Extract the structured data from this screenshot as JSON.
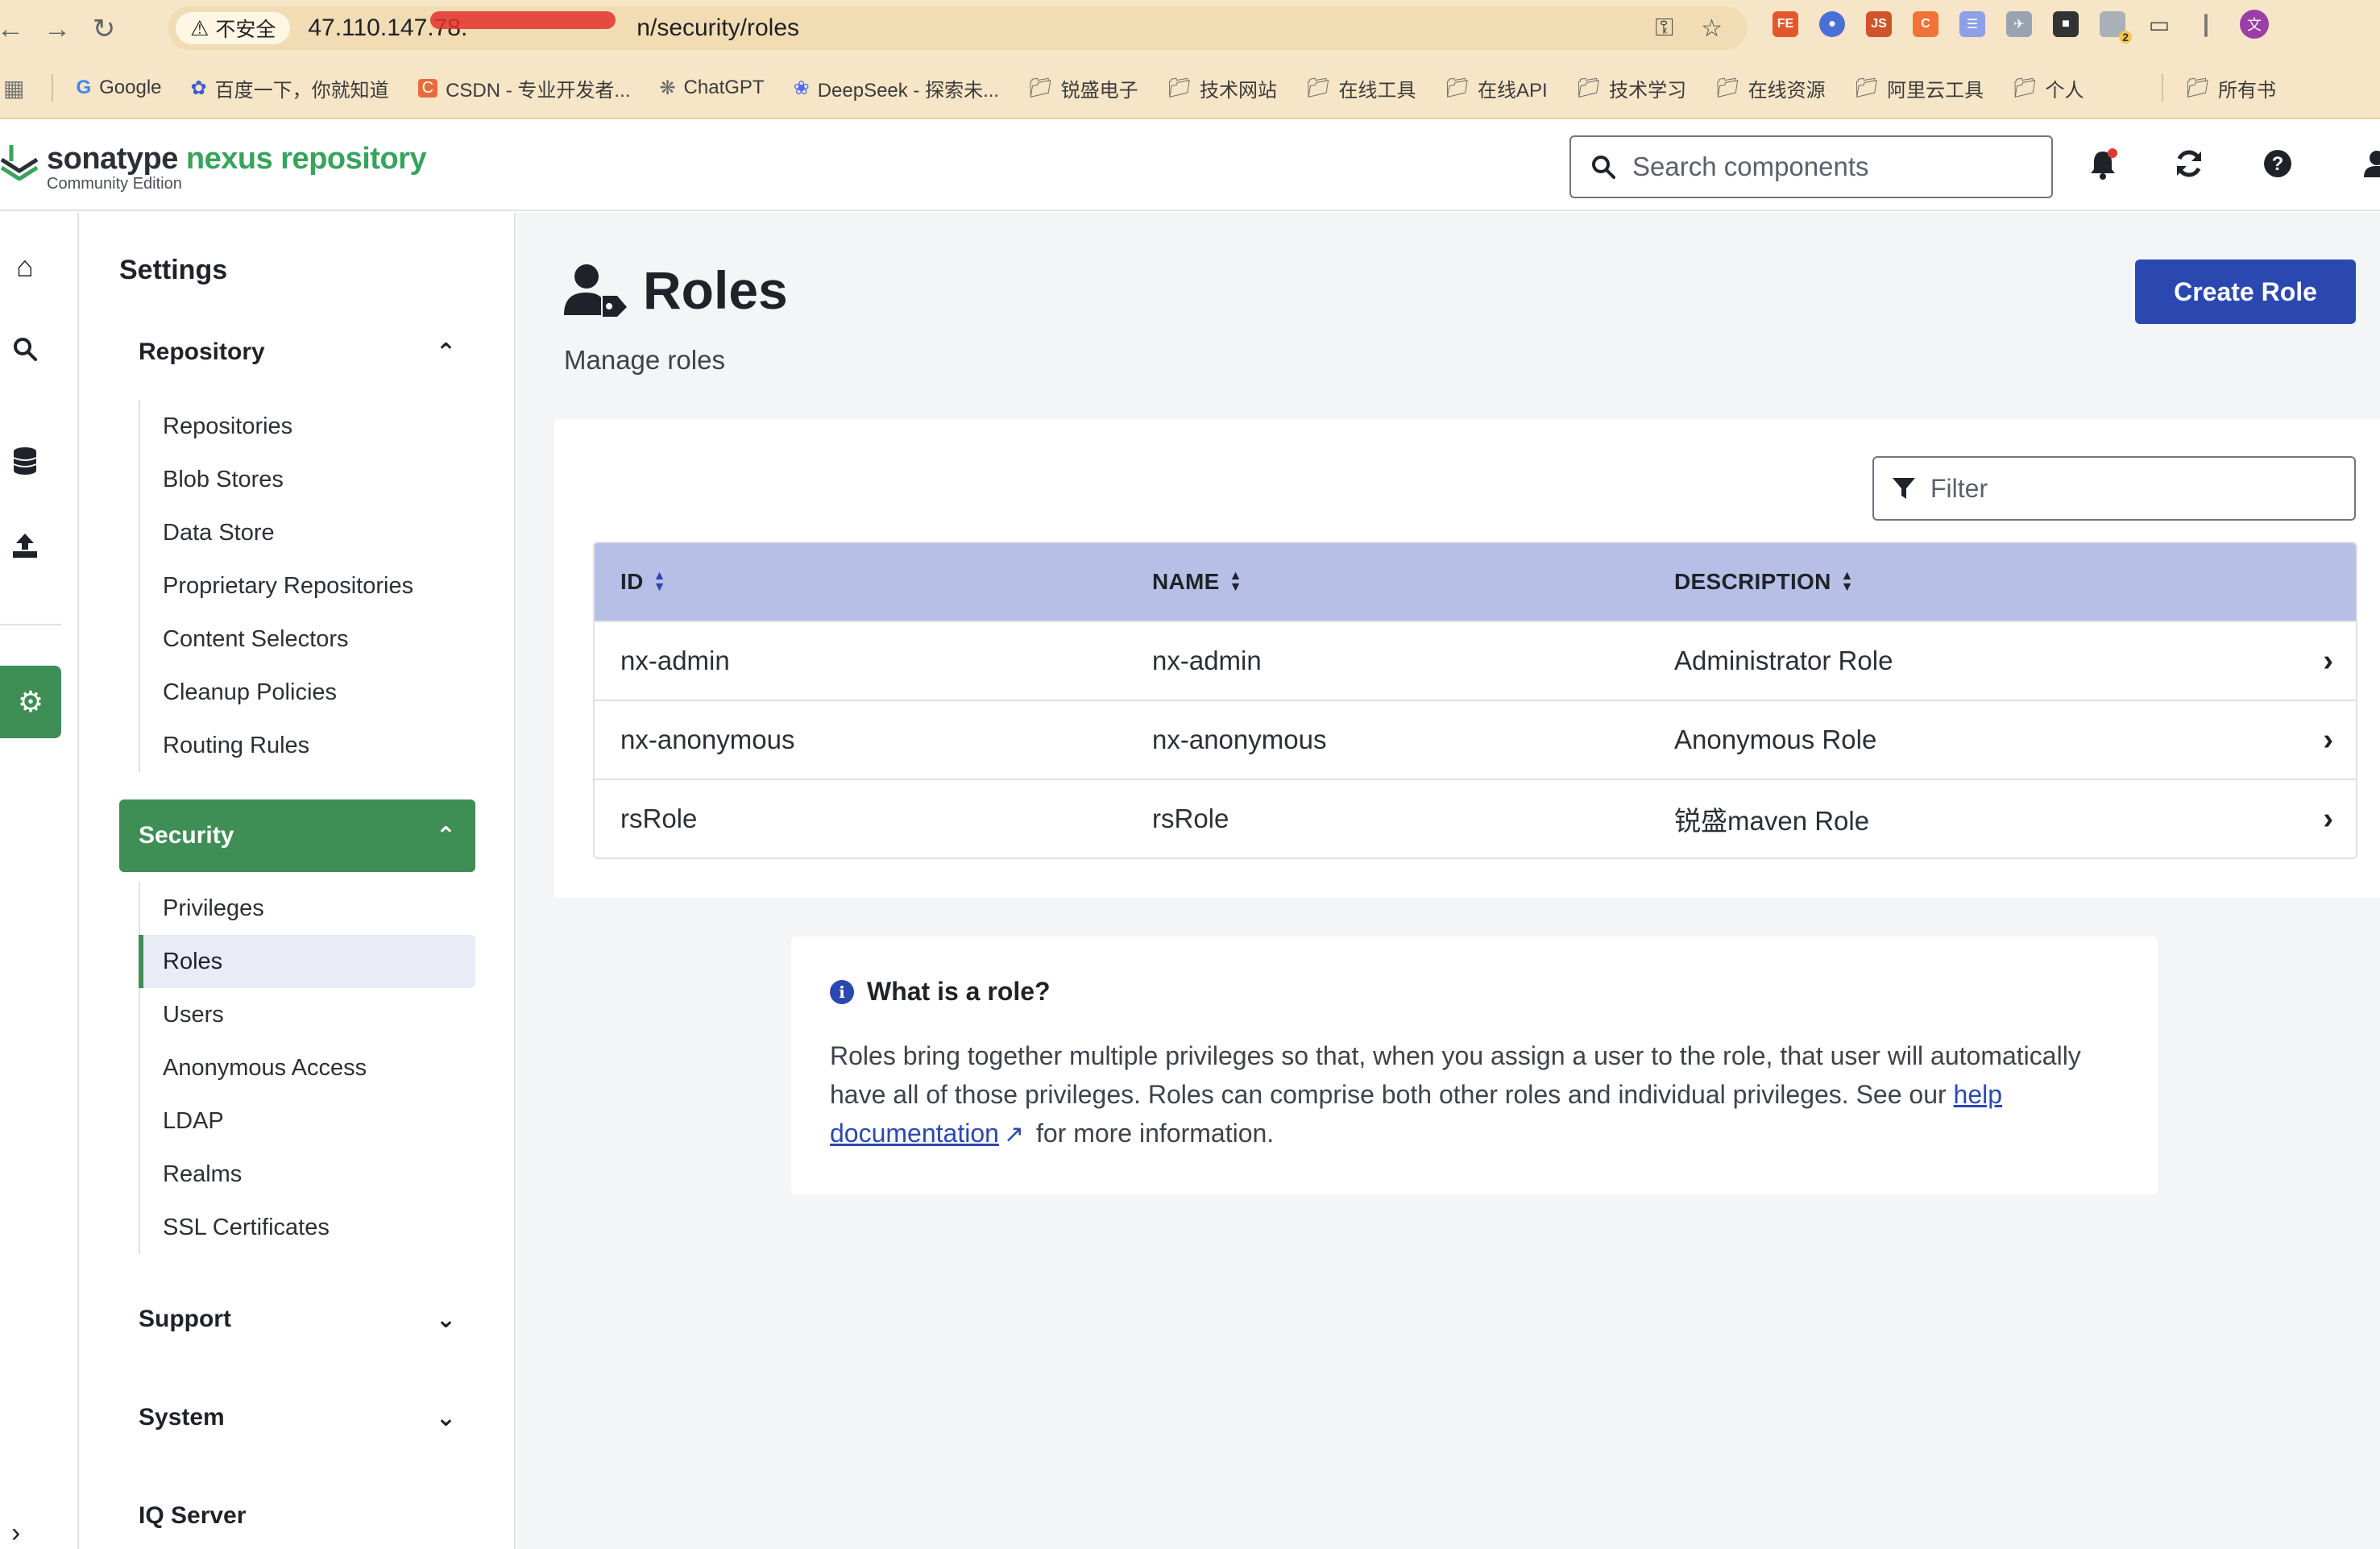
{
  "browser": {
    "back_icon": "arrow-left-icon",
    "forward_icon": "arrow-right-icon",
    "reload_icon": "reload-icon",
    "security_chip": "不安全",
    "url_visible": "47.110.147.78.",
    "url_tail": "n/security/roles",
    "bookmarks": [
      {
        "label": "Google",
        "icon": "google-icon"
      },
      {
        "label": "百度一下，你就知道",
        "icon": "baidu-icon"
      },
      {
        "label": "CSDN - 专业开发者...",
        "icon": "csdn-icon"
      },
      {
        "label": "ChatGPT",
        "icon": "chatgpt-icon"
      },
      {
        "label": "DeepSeek - 探索未...",
        "icon": "deepseek-icon"
      },
      {
        "label": "锐盛电子",
        "icon": "folder-icon"
      },
      {
        "label": "技术网站",
        "icon": "folder-icon"
      },
      {
        "label": "在线工具",
        "icon": "folder-icon"
      },
      {
        "label": "在线API",
        "icon": "folder-icon"
      },
      {
        "label": "技术学习",
        "icon": "folder-icon"
      },
      {
        "label": "在线资源",
        "icon": "folder-icon"
      },
      {
        "label": "阿里云工具",
        "icon": "folder-icon"
      },
      {
        "label": "个人",
        "icon": "folder-icon"
      }
    ],
    "other_bookmarks": "所有书",
    "profile_initial": "文",
    "extension_badge": "2"
  },
  "header": {
    "logo_brand": "sonatype",
    "logo_product": "nexus repository",
    "logo_edition": "Community Edition",
    "search_placeholder": "Search components"
  },
  "settings": {
    "title": "Settings",
    "repository": {
      "label": "Repository",
      "items": [
        "Repositories",
        "Blob Stores",
        "Data Store",
        "Proprietary Repositories",
        "Content Selectors",
        "Cleanup Policies",
        "Routing Rules"
      ]
    },
    "security": {
      "label": "Security",
      "items": [
        "Privileges",
        "Roles",
        "Users",
        "Anonymous Access",
        "LDAP",
        "Realms",
        "SSL Certificates"
      ]
    },
    "support": {
      "label": "Support"
    },
    "system": {
      "label": "System"
    },
    "iq_server": {
      "label": "IQ Server"
    }
  },
  "main": {
    "title": "Roles",
    "subtitle": "Manage roles",
    "create_button": "Create Role",
    "filter_placeholder": "Filter",
    "columns": [
      "ID",
      "NAME",
      "DESCRIPTION"
    ],
    "rows": [
      {
        "id": "nx-admin",
        "name": "nx-admin",
        "description": "Administrator Role"
      },
      {
        "id": "nx-anonymous",
        "name": "nx-anonymous",
        "description": "Anonymous Role"
      },
      {
        "id": "rsRole",
        "name": "rsRole",
        "description": "锐盛maven Role"
      }
    ],
    "info": {
      "title": "What is a role?",
      "body_pre": "Roles bring together multiple privileges so that, when you assign a user to the role, that user will automatically have all of those privileges. Roles can comprise both other roles and individual privileges. See our ",
      "link": "help documentation",
      "body_post": " for more information."
    }
  },
  "colors": {
    "accent_green": "#3e8e55",
    "primary_blue": "#2b48b1",
    "table_header": "#b8bfe6",
    "browser_chrome": "#f6e5c6"
  }
}
